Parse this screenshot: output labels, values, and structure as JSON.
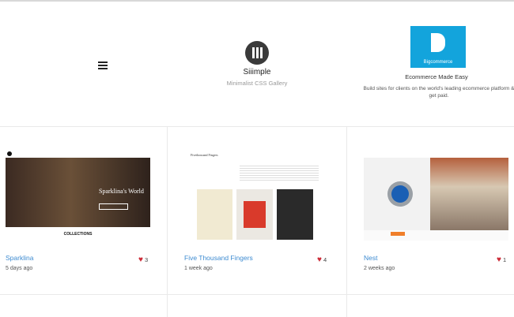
{
  "header": {
    "brand_name": "Siiimple",
    "brand_tagline": "Minimalist CSS Gallery"
  },
  "ad": {
    "image_text": "Bigcommerce",
    "title": "Ecommerce Made Easy",
    "description": "Build sites for clients on the world's leading ecommerce platform & get paid."
  },
  "cards": [
    {
      "title": "Sparklina",
      "date": "5 days ago",
      "likes": "3",
      "thumb_title": "Sparklina's World",
      "thumb_collections": "COLLECTIONS"
    },
    {
      "title": "Five Thousand Fingers",
      "date": "1 week ago",
      "likes": "4",
      "thumb_head": "Fivethousand Fingers"
    },
    {
      "title": "Nest",
      "date": "2 weeks ago",
      "likes": "1"
    }
  ],
  "colors": {
    "link": "#3d8bd1",
    "heart": "#cc2a36",
    "ad_bg": "#13a4dc"
  }
}
